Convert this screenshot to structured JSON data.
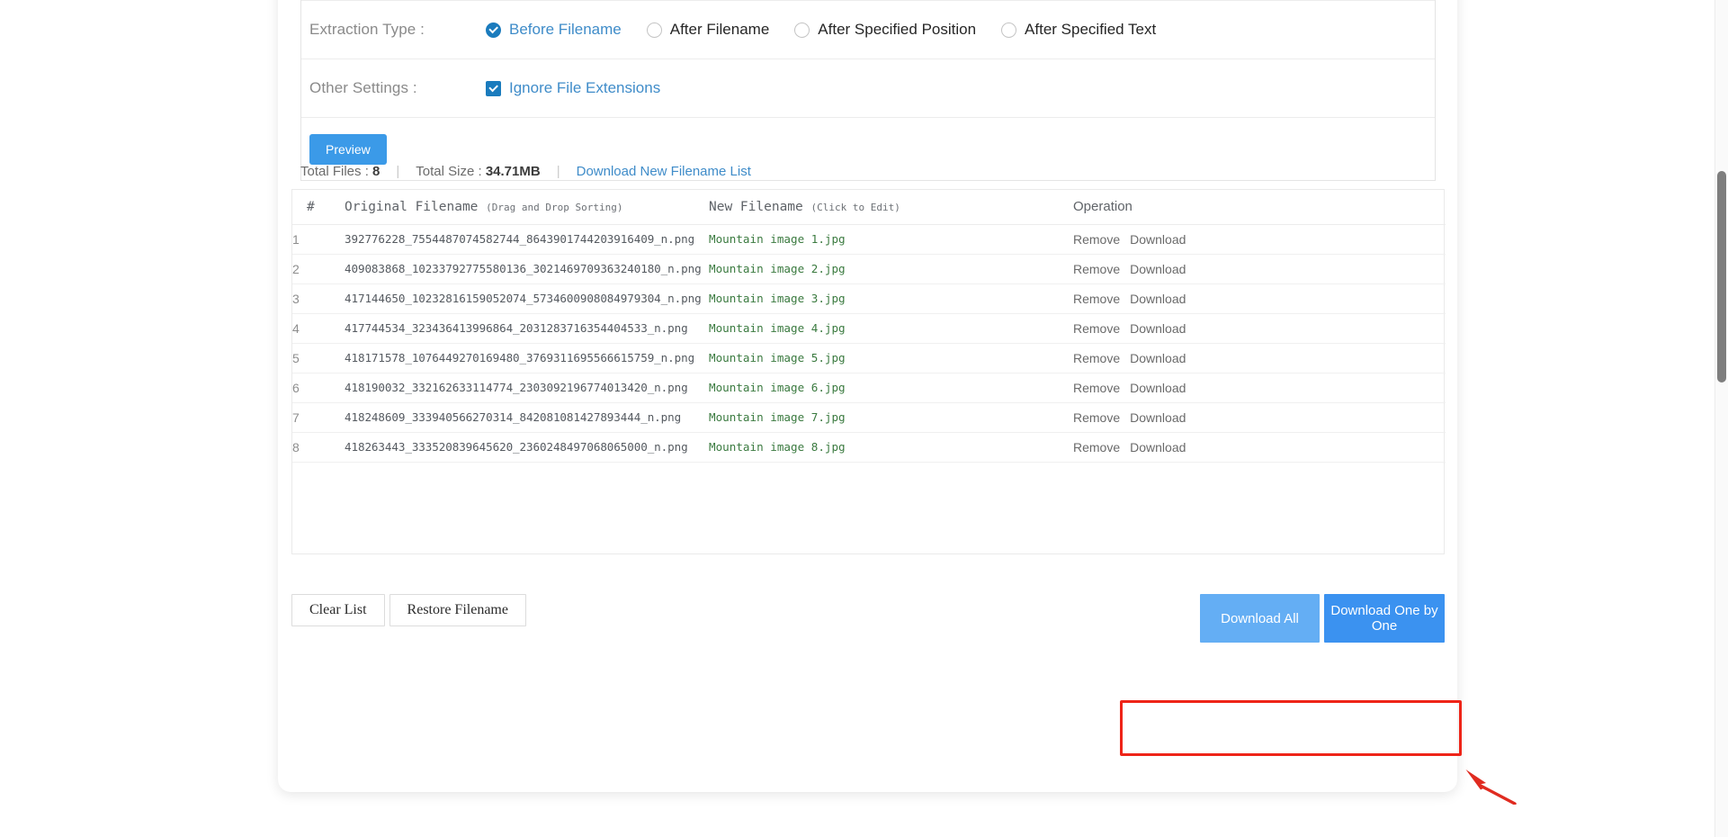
{
  "settings": {
    "extraction_type": {
      "label": "Extraction Type :",
      "options": [
        {
          "label": "Before Filename",
          "selected": true
        },
        {
          "label": "After Filename",
          "selected": false
        },
        {
          "label": "After Specified Position",
          "selected": false
        },
        {
          "label": "After Specified Text",
          "selected": false
        }
      ]
    },
    "other_settings": {
      "label": "Other Settings :",
      "ignore_file_extensions": {
        "label": "Ignore File Extensions",
        "checked": true
      }
    },
    "preview_button": "Preview"
  },
  "summary": {
    "total_files_label": "Total Files :",
    "total_files_value": "8",
    "total_size_label": "Total Size :",
    "total_size_value": "34.71MB",
    "download_list_link": "Download New Filename List",
    "separator": "|"
  },
  "table": {
    "headers": {
      "num": "#",
      "original": "Original Filename",
      "original_hint": "(Drag and Drop Sorting)",
      "new": "New Filename",
      "new_hint": "(Click to Edit)",
      "operation": "Operation"
    },
    "op_labels": {
      "remove": "Remove",
      "download": "Download"
    },
    "rows": [
      {
        "num": "1",
        "original": "392776228_7554487074582744_8643901744203916409_n.png",
        "new": "Mountain image 1.jpg"
      },
      {
        "num": "2",
        "original": "409083868_10233792775580136_3021469709363240180_n.png",
        "new": "Mountain image 2.jpg"
      },
      {
        "num": "3",
        "original": "417144650_10232816159052074_5734600908084979304_n.png",
        "new": "Mountain image 3.jpg"
      },
      {
        "num": "4",
        "original": "417744534_323436413996864_2031283716354404533_n.png",
        "new": "Mountain image 4.jpg"
      },
      {
        "num": "5",
        "original": "418171578_1076449270169480_3769311695566615759_n.png",
        "new": "Mountain image 5.jpg"
      },
      {
        "num": "6",
        "original": "418190032_332162633114774_2303092196774013420_n.png",
        "new": "Mountain image 6.jpg"
      },
      {
        "num": "7",
        "original": "418248609_333940566270314_842081081427893444_n.png",
        "new": "Mountain image 7.jpg"
      },
      {
        "num": "8",
        "original": "418263443_333520839645620_2360248497068065000_n.png",
        "new": "Mountain image 8.jpg"
      }
    ]
  },
  "footer": {
    "clear_list": "Clear List",
    "restore_filename": "Restore Filename",
    "download_all": "Download All",
    "download_one_by_one": "Download One by One"
  },
  "colors": {
    "accent_blue": "#3b9ae8",
    "link_blue": "#3f8cc9",
    "new_filename_green": "#3a7a3f",
    "annotation_red": "#ee2418",
    "download_all_blue": "#64aef4",
    "download_one_blue": "#3b92f0"
  }
}
